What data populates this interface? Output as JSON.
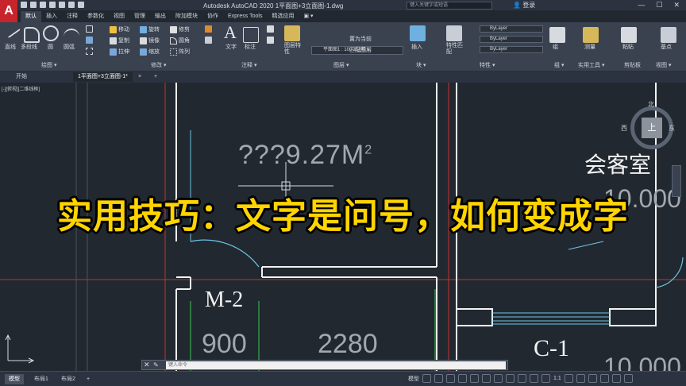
{
  "app": {
    "logo": "A",
    "title": "Autodesk AutoCAD 2020   1平面图+3立面图-1.dwg",
    "search_placeholder": "键入关键字或短语",
    "login": "登录",
    "window_buttons": [
      "—",
      "☐",
      "✕"
    ]
  },
  "ribbon_tabs": [
    "默认",
    "插入",
    "注释",
    "参数化",
    "视图",
    "管理",
    "输出",
    "附加模块",
    "协作",
    "Express Tools",
    "精选应用",
    "▣ ▾"
  ],
  "tools": {
    "line": "直线",
    "polyline": "多段线",
    "circle": "圆",
    "arc": "圆弧",
    "move": "移动",
    "rotate": "旋转",
    "trim": "修剪",
    "copy": "复制",
    "mirror": "镜像",
    "fillet": "圆角",
    "stretch": "拉伸",
    "scale": "缩放",
    "array": "阵列",
    "text": "文字",
    "dimension": "标注",
    "layer_properties": "图层特性",
    "layer_combo": "平面图1 : 100-8注释 ▾",
    "set_current": "置为当前",
    "match_layer": "匹配图层",
    "insert": "插入",
    "properties_match": "特性匹配",
    "bylayer": "ByLayer",
    "group": "组",
    "measure": "测量",
    "paste": "粘贴",
    "base": "基点"
  },
  "panel_labels": [
    "绘图 ▾",
    "修改 ▾",
    "注释 ▾",
    "图层 ▾",
    "块 ▾",
    "特性 ▾",
    "组 ▾",
    "实用工具 ▾",
    "剪贴板",
    "视图 ▾"
  ],
  "doc_tabs": [
    "开始",
    "1平面图+3立面图-1*",
    "×",
    "+"
  ],
  "viewport_label": "[-][俯视][二维线框]",
  "drawing": {
    "garbled_text": "???9.27M",
    "superscript": "2",
    "room_name": "会客室",
    "door_label": "M-2",
    "window_label": "C-1",
    "dim_1": "900",
    "dim_2": "2280",
    "partial_number": "10.000",
    "partial_number_bottom": "10.000"
  },
  "viewcube": {
    "north": "北",
    "west": "西",
    "east": "东",
    "top": "上"
  },
  "headline": "实用技巧：文字是问号，如何变成字",
  "command": {
    "close": "✕",
    "placeholder": "键入命令"
  },
  "layout_tabs": [
    "模型",
    "布局1",
    "布局2",
    "+"
  ],
  "statusbar": {
    "model": "模型",
    "scale": "1:1"
  }
}
